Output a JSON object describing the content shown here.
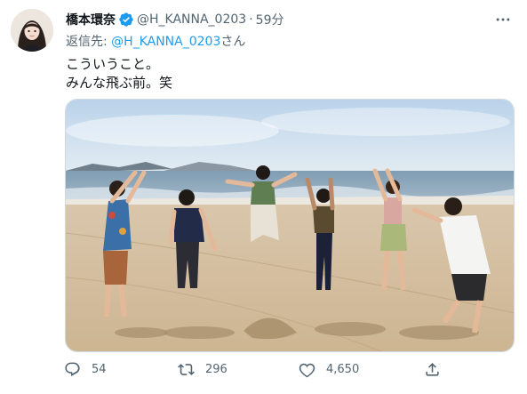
{
  "tweet": {
    "display_name": "橋本環奈",
    "handle": "@H_KANNA_0203",
    "separator": "·",
    "time": "59分",
    "reply_prefix": "返信先: ",
    "reply_mention": "@H_KANNA_0203",
    "reply_suffix": "さん",
    "text_lines": [
      "こういうこと。",
      "みんな飛ぶ前。笑"
    ],
    "verified_icon": "verified-badge-icon",
    "avatar_icon": "profile-avatar",
    "photo_subject": "beach-jump-group-photo"
  },
  "actions": {
    "reply_count": "54",
    "retweet_count": "296",
    "like_count": "4,650",
    "icons": [
      "reply-icon",
      "retweet-icon",
      "like-icon",
      "share-icon"
    ]
  },
  "colors": {
    "accent": "#1d9bf0",
    "text_primary": "#0f1419",
    "text_secondary": "#536471",
    "border": "#cfd9de"
  }
}
